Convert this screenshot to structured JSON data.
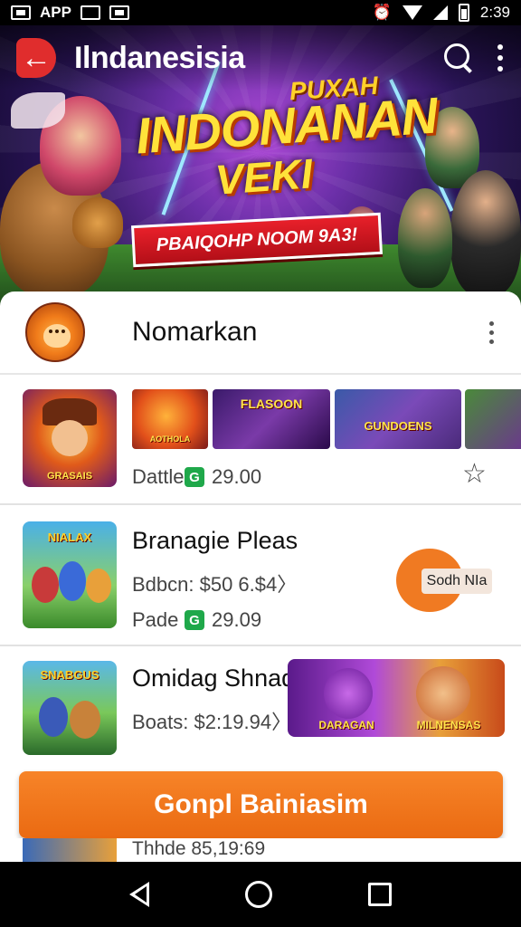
{
  "status_bar": {
    "left_text": "APP",
    "time": "2:39",
    "icons": [
      "notification-box-icon",
      "photo-icon",
      "message-icon",
      "alarm-icon",
      "wifi-icon",
      "signal-icon",
      "battery-icon"
    ]
  },
  "app_bar": {
    "title": "Ilndanesisia",
    "back_icon": "back-arrow-icon",
    "search_icon": "search-icon",
    "more_icon": "more-vert-icon"
  },
  "hero": {
    "subtitle": "PUXAH",
    "title_line1": "INDONANAN",
    "title_line2": "VEKI",
    "ribbon": "PBAIQOHP NOOM 9A3!"
  },
  "profile": {
    "name": "Nomarkan"
  },
  "items": [
    {
      "thumb_label": "GRASAIS",
      "title": "",
      "sub_label": "Dattle",
      "price": "29.00",
      "price_badge": "G",
      "screenshot_labels": [
        "AOTHOLA",
        "FLASOON",
        "GUNDOENS",
        ""
      ],
      "star_icon": "star-outline-icon"
    },
    {
      "thumb_label": "NIALAX",
      "title": "Branagie Pleas",
      "sub_label": "Bdbcn: $50 6.$4〉",
      "price_label": "Pade",
      "price": "29.09",
      "price_badge": "G",
      "install_chip": "Sodh NIa"
    },
    {
      "thumb_label": "SNABGUS",
      "title": "Omidag Shnad",
      "sub_label": "Boats: $2:19.94〉",
      "promo_labels": [
        "DARAGAN",
        "MILNENSAS"
      ]
    }
  ],
  "cta": {
    "label": "Gonpl Bainiasim"
  },
  "peek": {
    "text": "Thhde 85,19:69"
  },
  "nav_bar": {
    "back_icon": "nav-back-icon",
    "home_icon": "nav-home-icon",
    "recent_icon": "nav-recent-apps-icon"
  },
  "colors": {
    "accent_orange": "#f07a22",
    "price_green": "#1fa84a",
    "title_yellow": "#ffe23a",
    "ribbon_red": "#e8202a"
  }
}
